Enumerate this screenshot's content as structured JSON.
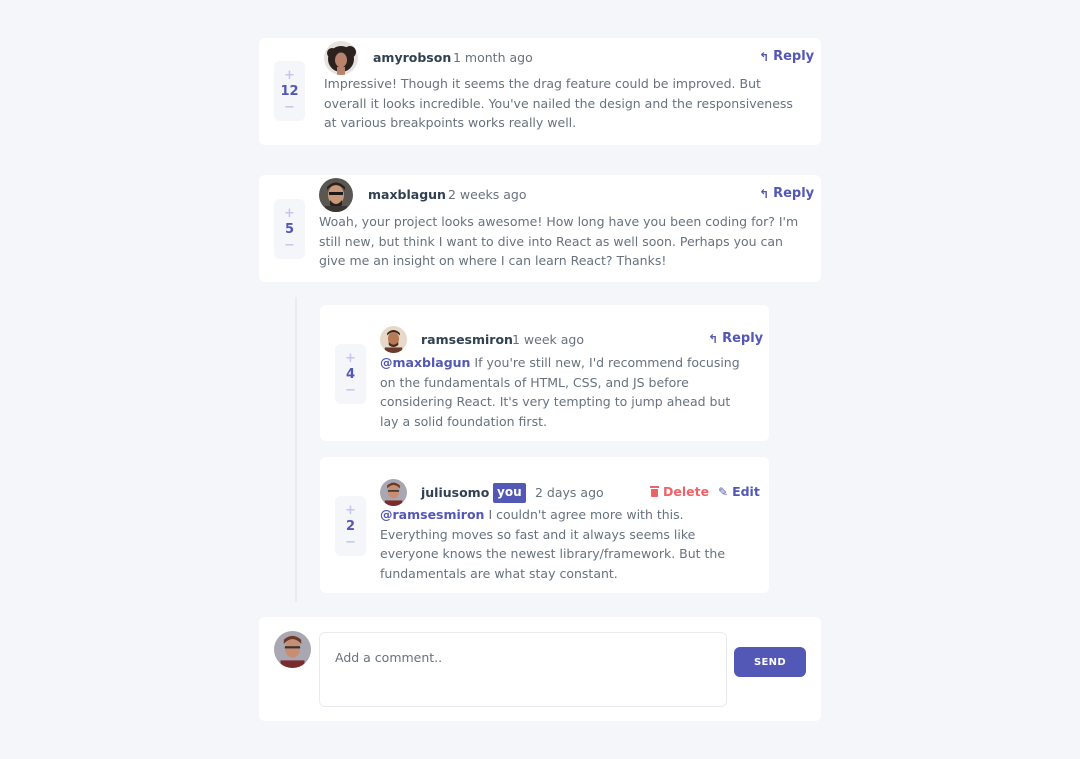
{
  "comments": [
    {
      "username": "amyrobson",
      "time": "1 month ago",
      "score": "12",
      "reply_label": "Reply",
      "content": "Impressive! Though it seems the drag feature could be improved. But overall it looks incredible. You've nailed the design and the responsiveness at various breakpoints works really well."
    },
    {
      "username": "maxblagun",
      "time": "2 weeks ago",
      "score": "5",
      "reply_label": "Reply",
      "content": "Woah, your project looks awesome! How long have you been coding for? I'm still new, but think I want to dive into React as well soon. Perhaps you can give me an insight on where I can learn React? Thanks!"
    }
  ],
  "replies": [
    {
      "username": "ramsesmiron",
      "time": "1 week ago",
      "score": "4",
      "reply_label": "Reply",
      "mention": "@maxblagun",
      "content": "If you're still new, I'd recommend focusing on the fundamentals of HTML, CSS, and JS before considering React. It's very tempting to jump ahead but lay a solid foundation first."
    },
    {
      "username": "juliusomo",
      "you_badge": "you",
      "time": "2 days ago",
      "score": "2",
      "delete_label": "Delete",
      "edit_label": "Edit",
      "mention": "@ramsesmiron",
      "content": "I couldn't agree more with this. Everything moves so fast and it always seems like everyone knows the newest library/framework. But the fundamentals are what stay constant."
    }
  ],
  "vote": {
    "plus": "+",
    "minus": "−"
  },
  "new_comment": {
    "placeholder": "Add a comment..",
    "send_label": "SEND"
  },
  "icons": {
    "reply": "reply-arrow-icon",
    "delete": "trash-icon",
    "edit": "pencil-icon"
  },
  "colors": {
    "accent": "#5357b6",
    "danger": "#ed6368",
    "background": "#f5f6fa",
    "heading": "#324152",
    "body_text": "#67727e"
  }
}
